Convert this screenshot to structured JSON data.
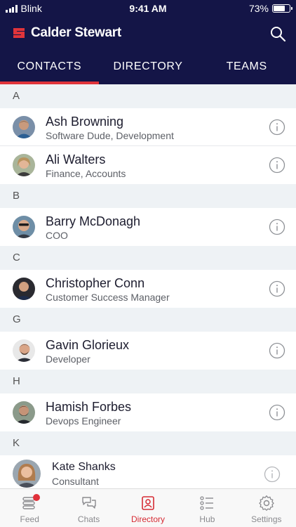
{
  "status_bar": {
    "carrier": "Blink",
    "time": "9:41 AM",
    "battery": "73%",
    "battery_level": 0.73
  },
  "brand": {
    "name": "Calder Stewart",
    "accent_color": "#e0343b",
    "header_color": "#141547"
  },
  "header": {
    "search_icon": "search-icon"
  },
  "tabs": [
    {
      "label": "CONTACTS",
      "active": true
    },
    {
      "label": "DIRECTORY",
      "active": false
    },
    {
      "label": "TEAMS",
      "active": false
    }
  ],
  "sections": [
    {
      "letter": "A",
      "contacts": [
        {
          "name": "Ash Browning",
          "role": "Software Dude, Development"
        },
        {
          "name": "Ali Walters",
          "role": "Finance, Accounts"
        }
      ]
    },
    {
      "letter": "B",
      "contacts": [
        {
          "name": "Barry McDonagh",
          "role": "COO"
        }
      ]
    },
    {
      "letter": "C",
      "contacts": [
        {
          "name": "Christopher Conn",
          "role": "Customer Success Manager"
        }
      ]
    },
    {
      "letter": "G",
      "contacts": [
        {
          "name": "Gavin Glorieux",
          "role": "Developer"
        }
      ]
    },
    {
      "letter": "H",
      "contacts": [
        {
          "name": "Hamish Forbes",
          "role": "Devops Engineer"
        }
      ]
    },
    {
      "letter": "K",
      "contacts": [
        {
          "name": "Kate Shanks",
          "role": "Consultant"
        }
      ]
    }
  ],
  "tab_bar": [
    {
      "label": "Feed",
      "icon": "feed-icon",
      "active": false,
      "has_badge": true
    },
    {
      "label": "Chats",
      "icon": "chat-bubbles-icon",
      "active": false
    },
    {
      "label": "Directory",
      "icon": "contact-book-icon",
      "active": true
    },
    {
      "label": "Hub",
      "icon": "list-icon",
      "active": false
    },
    {
      "label": "Settings",
      "icon": "gear-icon",
      "active": false
    }
  ]
}
